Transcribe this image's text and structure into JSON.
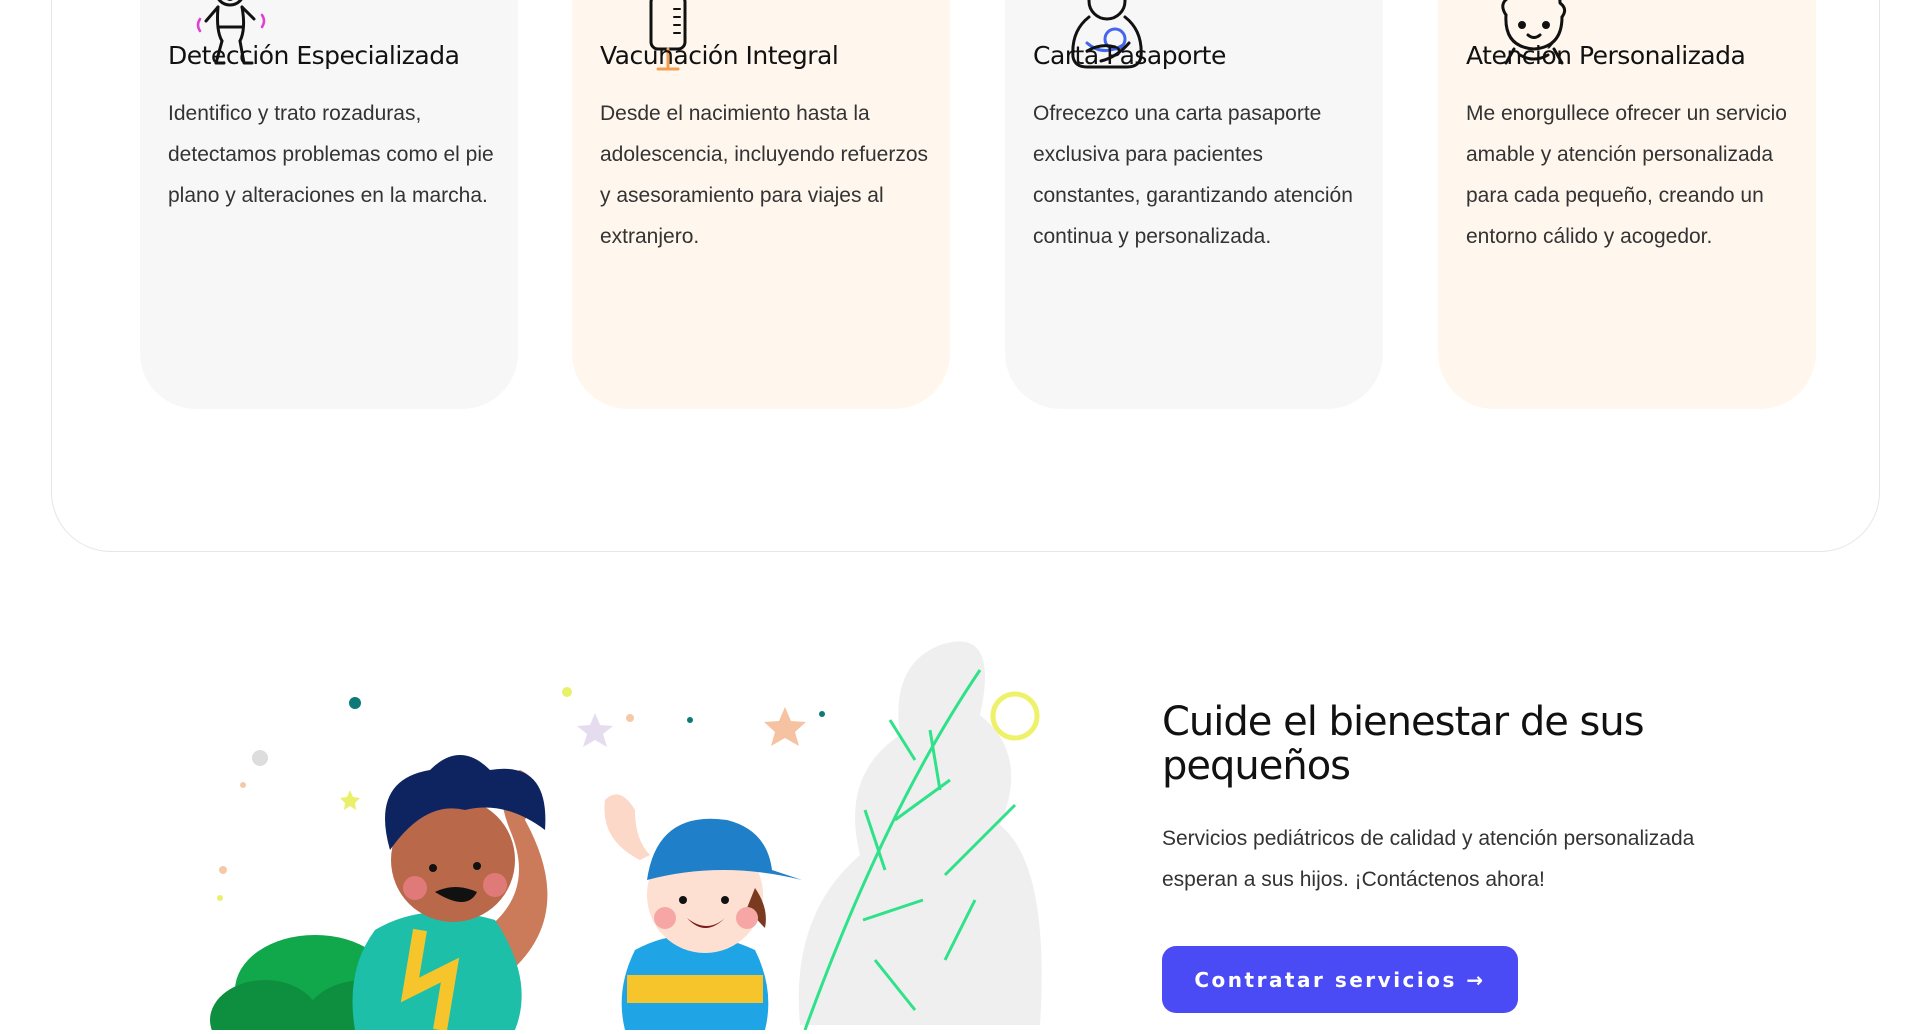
{
  "services": [
    {
      "title": "Detección Especializada",
      "text": "Identifico y trato rozaduras, detectamos problemas como el pie plano y alteraciones en la marcha.",
      "icon": "baby-walking-icon"
    },
    {
      "title": "Vacunación Integral",
      "text": "Desde el nacimiento hasta la adolescencia, incluyendo refuerzos y asesoramiento para viajes al extranjero.",
      "icon": "syringe-icon"
    },
    {
      "title": "Carta Pasaporte",
      "text": "Ofrecezco una carta pasaporte exclusiva para pacientes constantes, garantizando atención continua y personalizada.",
      "icon": "mother-baby-icon"
    },
    {
      "title": "Atención Personalizada",
      "text": "Me enorgullece ofrecer un servicio amable y atención personalizada para cada pequeño, creando un entorno cálido y acogedor.",
      "icon": "girl-face-icon"
    }
  ],
  "cta": {
    "title": "Cuide el bienestar de sus pequeños",
    "text": "Servicios pediátricos de calidad y atención personalizada esperan a sus hijos. ¡Contáctenos ahora!",
    "button_label": "Contratar servicios →"
  },
  "colors": {
    "card_grey": "#f7f7f7",
    "card_peach": "#fff7ee",
    "button": "#4a4bf4",
    "icon_accent_pink": "#e040d0",
    "icon_accent_orange": "#f0a050",
    "icon_accent_blue": "#4466ee"
  }
}
